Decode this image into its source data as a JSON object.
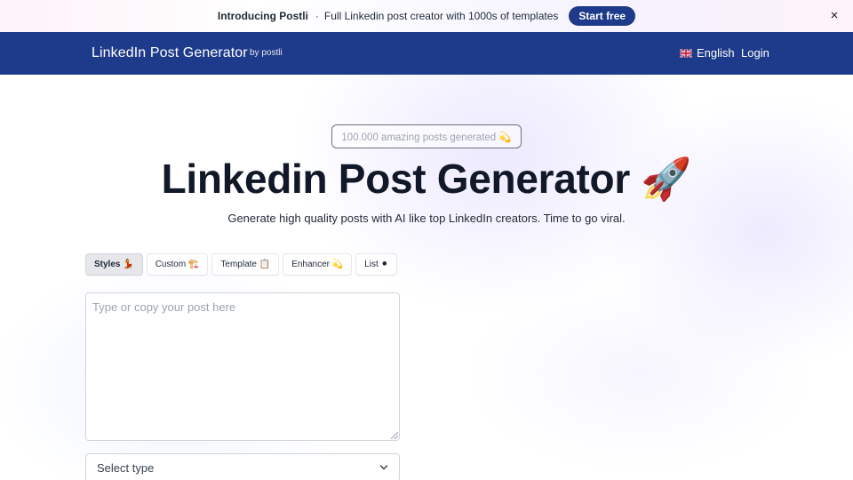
{
  "announcement": {
    "title": "Introducing Postli",
    "separator": "·",
    "text": "Full Linkedin post creator with 1000s of templates",
    "cta": "Start free",
    "close": "×"
  },
  "navbar": {
    "brand": "LinkedIn Post Generator",
    "by": "by postli",
    "language": "English",
    "login": "Login"
  },
  "hero": {
    "counter": "100.000 amazing posts generated 💫",
    "title": "Linkedin Post Generator 🚀",
    "subtitle": "Generate high quality posts with AI like top LinkedIn creators. Time to go viral."
  },
  "tabs": [
    {
      "label": "Styles 💃",
      "active": true
    },
    {
      "label": "Custom 🏗️",
      "active": false
    },
    {
      "label": "Template 📋",
      "active": false
    },
    {
      "label": "Enhancer 💫",
      "active": false
    },
    {
      "label": "List ⚫",
      "active": false
    }
  ],
  "editor": {
    "placeholder": "Type or copy your post here",
    "value": ""
  },
  "type_select": {
    "selected": "Select type"
  },
  "colors": {
    "navbar": "#1e3a8a",
    "cta": "#1e3a8a",
    "title": "#111827"
  }
}
